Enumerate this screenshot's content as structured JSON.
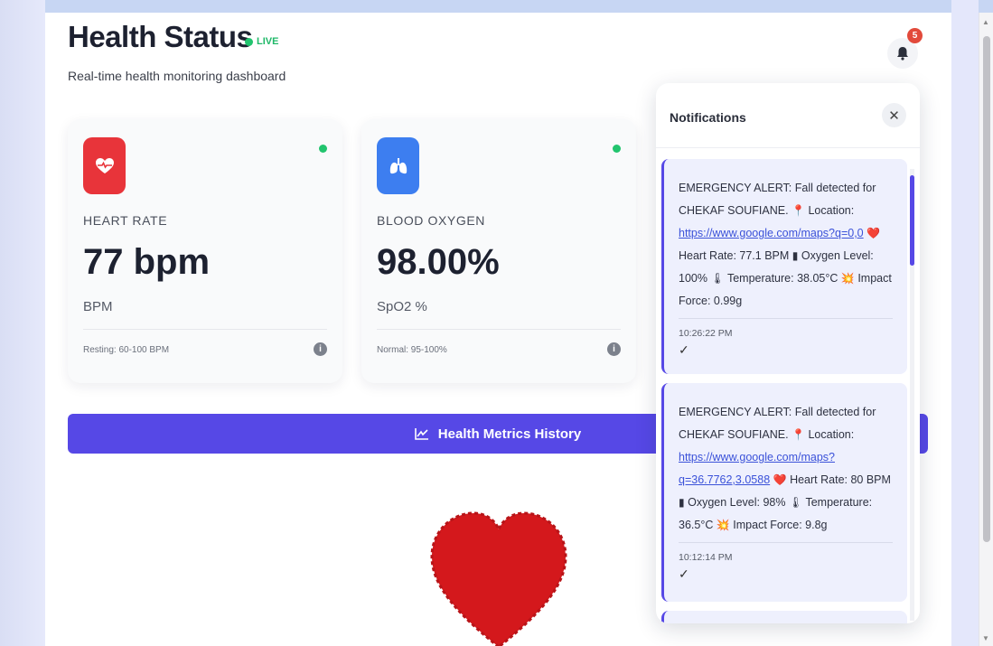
{
  "header": {
    "title": "Health Status",
    "live_label": "LIVE",
    "subtitle": "Real-time health monitoring dashboard",
    "notification_count": "5"
  },
  "cards": [
    {
      "icon": "heart-pulse-icon",
      "label": "HEART RATE",
      "value": "77 bpm",
      "unit": "BPM",
      "range": "Resting: 60-100 BPM",
      "color": "#e8343a"
    },
    {
      "icon": "lungs-icon",
      "label": "BLOOD OXYGEN",
      "value": "98.00%",
      "unit": "SpO2 %",
      "range": "Normal: 95-100%",
      "color": "#3d7ef0"
    }
  ],
  "history_button": {
    "label": "Health Metrics History",
    "icon": "trend-icon"
  },
  "notifications": {
    "title": "Notifications",
    "items": [
      {
        "pre": "EMERGENCY ALERT: Fall detected for CHEKAF SOUFIANE.",
        "location_label": "Location:",
        "link": "https://www.google.com/maps?q=0,0",
        "heart": "Heart Rate: 77.1 BPM",
        "oxygen": "Oxygen Level: 100%",
        "temp": "Temperature: 38.05°C",
        "impact": "Impact Force: 0.99g",
        "time": "10:26:22 PM"
      },
      {
        "pre": "EMERGENCY ALERT: Fall detected for CHEKAF SOUFIANE.",
        "location_label": "Location:",
        "link": "https://www.google.com/maps?q=36.7762,3.0588",
        "heart": "Heart Rate: 80 BPM",
        "oxygen": "Oxygen Level: 98%",
        "temp": "Temperature: 36.5°C",
        "impact": "Impact Force: 9.8g",
        "time": "10:12:14 PM"
      }
    ]
  },
  "colors": {
    "accent": "#5648e6",
    "live_green": "#22c46e",
    "badge_red": "#e24a3b"
  }
}
